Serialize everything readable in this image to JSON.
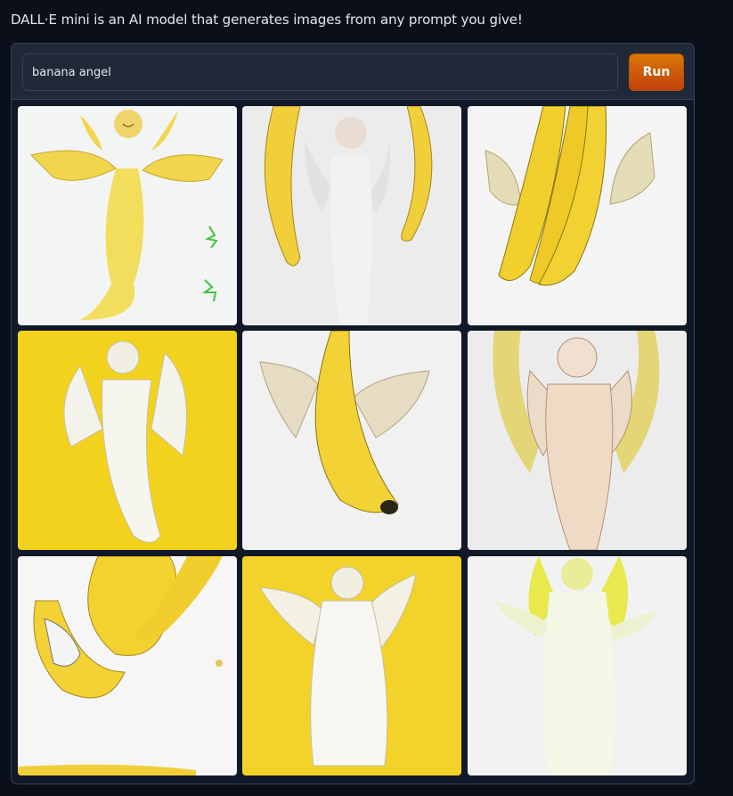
{
  "header": {
    "description": "DALL·E mini is an AI model that generates images from any prompt you give!"
  },
  "prompt": {
    "value": "banana angel"
  },
  "run_button": {
    "label": "Run"
  },
  "gallery": {
    "images": [
      {
        "subject": "banana-angel-figure",
        "background": "#f3f4f4"
      },
      {
        "subject": "white-robed-angel-between-bananas",
        "background": "#ececec"
      },
      {
        "subject": "banana-bunch-with-wings",
        "background": "#f4f4f4"
      },
      {
        "subject": "white-banana-angel-on-yellow",
        "background": "#f2d21c"
      },
      {
        "subject": "winged-banana",
        "background": "#f1f1f1"
      },
      {
        "subject": "carved-angel-statue",
        "background": "#ececec"
      },
      {
        "subject": "banana-and-bird-abstract",
        "background": "#f6f6f6"
      },
      {
        "subject": "white-angel-on-yellow",
        "background": "#f3d22a"
      },
      {
        "subject": "pale-angel-figure",
        "background": "#f2f2f2"
      }
    ]
  },
  "colors": {
    "accent": "#d97706",
    "page_bg": "#0b0f19",
    "panel_bg": "#1f2937",
    "border": "#374151"
  }
}
